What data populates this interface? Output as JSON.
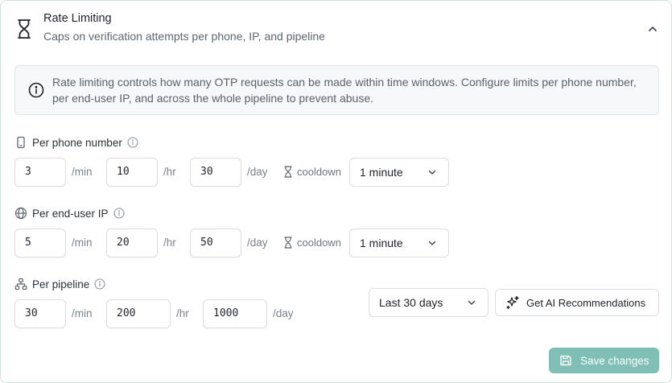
{
  "header": {
    "title": "Rate Limiting",
    "subtitle": "Caps on verification attempts per phone, IP, and pipeline"
  },
  "info": {
    "text": "Rate limiting controls how many OTP requests can be made within time windows. Configure limits per phone number, per end-user IP, and across the whole pipeline to prevent abuse."
  },
  "units": {
    "min": "/min",
    "hr": "/hr",
    "day": "/day"
  },
  "cooldown_label": "cooldown",
  "phone": {
    "label": "Per phone number",
    "per_min": "3",
    "per_hr": "10",
    "per_day": "30",
    "cooldown": "1 minute"
  },
  "ip": {
    "label": "Per end-user IP",
    "per_min": "5",
    "per_hr": "20",
    "per_day": "50",
    "cooldown": "1 minute"
  },
  "pipeline": {
    "label": "Per pipeline",
    "per_min": "30",
    "per_hr": "200",
    "per_day": "1000",
    "range": "Last 30 days"
  },
  "actions": {
    "ai_recommendations": "Get AI Recommendations",
    "save": "Save changes"
  },
  "colors": {
    "accent_disabled": "#7fbfb5",
    "border": "#d9dee3"
  },
  "icons": [
    "hourglass-icon",
    "chevron-up-icon",
    "info-icon",
    "phone-icon",
    "globe-icon",
    "network-icon",
    "sparkles-icon",
    "save-icon"
  ]
}
